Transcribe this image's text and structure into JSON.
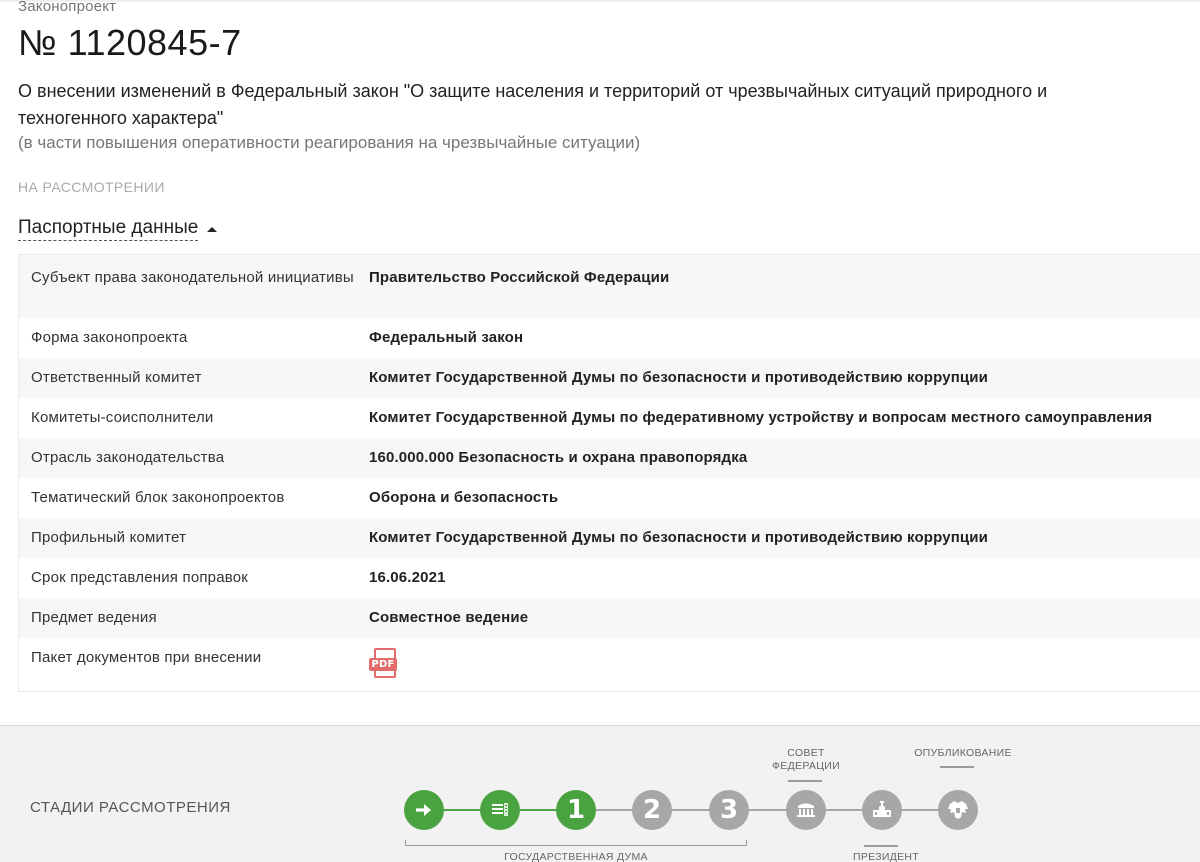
{
  "bill": {
    "type_label": "Законопроект",
    "number": "№ 1120845-7",
    "title": "О внесении изменений в Федеральный закон \"О защите населения и территорий от чрезвычайных ситуаций природного и техногенного характера\"",
    "subtitle": "(в части повышения оперативности реагирования на чрезвычайные ситуации)",
    "status": "НА РАССМОТРЕНИИ"
  },
  "passport": {
    "toggle_label": "Паспортные данные",
    "rows": [
      {
        "label": "Субъект права законодательной инициативы",
        "value": "Правительство Российской Федерации"
      },
      {
        "label": "Форма законопроекта",
        "value": "Федеральный закон"
      },
      {
        "label": "Ответственный комитет",
        "value": "Комитет Государственной Думы по безопасности и противодействию коррупции"
      },
      {
        "label": "Комитеты-соисполнители",
        "value": "Комитет Государственной Думы по федеративному устройству и вопросам местного самоуправления"
      },
      {
        "label": "Отрасль законодательства",
        "value": "160.000.000 Безопасность и охрана правопорядка"
      },
      {
        "label": "Тематический блок законопроектов",
        "value": "Оборона и безопасность"
      },
      {
        "label": "Профильный комитет",
        "value": "Комитет Государственной Думы по безопасности и противодействию коррупции"
      },
      {
        "label": "Срок представления поправок",
        "value": "16.06.2021"
      },
      {
        "label": "Предмет ведения",
        "value": "Совместное ведение"
      },
      {
        "label": "Пакет документов при внесении",
        "value": "PDF"
      }
    ]
  },
  "stages": {
    "title": "СТАДИИ РАССМОТРЕНИЯ",
    "items": [
      {
        "icon": "arrow-right-icon",
        "status": "done"
      },
      {
        "icon": "document-list-icon",
        "status": "done"
      },
      {
        "label": "1",
        "status": "active"
      },
      {
        "label": "2",
        "status": "pending"
      },
      {
        "label": "3",
        "status": "pending"
      },
      {
        "icon": "federation-council-icon",
        "status": "pending"
      },
      {
        "icon": "president-icon",
        "status": "pending"
      },
      {
        "icon": "emblem-icon",
        "status": "pending"
      }
    ],
    "labels": {
      "council": "СОВЕТ ФЕДЕРАЦИИ",
      "council_line1": "СОВЕТ",
      "council_line2": "ФЕДЕРАЦИИ",
      "publishing": "ОПУБЛИКОВАНИЕ",
      "duma": "ГОСУДАРСТВЕННАЯ ДУМА",
      "president": "ПРЕЗИДЕНТ"
    },
    "colors": {
      "done": "#4aa341",
      "pending": "#a7a7a7"
    }
  }
}
